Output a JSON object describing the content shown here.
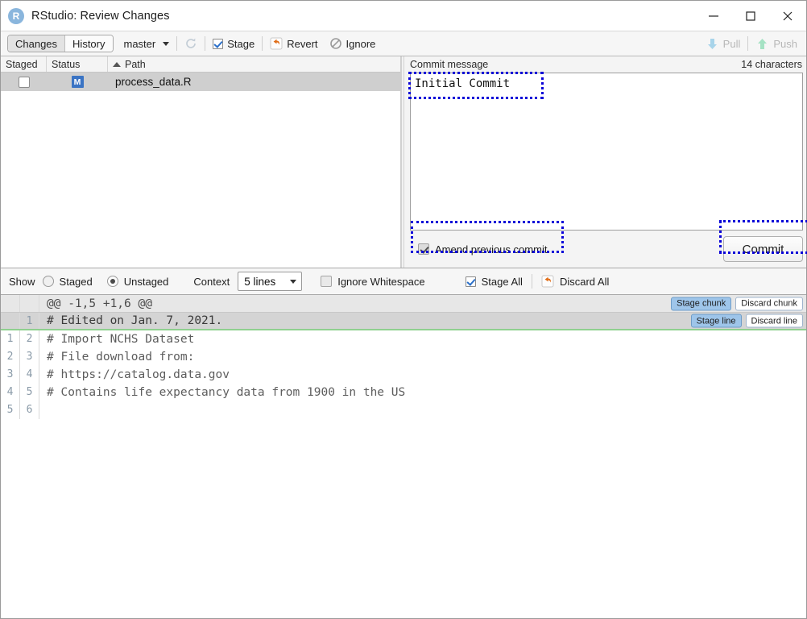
{
  "window": {
    "title": "RStudio: Review Changes",
    "logo_letter": "R",
    "logo_icon": "rstudio-logo-icon",
    "minimize_icon": "minimize-icon",
    "maximize_icon": "maximize-icon",
    "close_icon": "close-icon"
  },
  "toolbar": {
    "tab_changes": "Changes",
    "tab_history": "History",
    "branch": "master",
    "refresh_icon": "refresh-icon",
    "stage_label": "Stage",
    "revert_label": "Revert",
    "ignore_label": "Ignore",
    "pull_label": "Pull",
    "push_label": "Push"
  },
  "files": {
    "columns": [
      "Staged",
      "Status",
      "Path"
    ],
    "sort_column": "Path",
    "rows": [
      {
        "staged": false,
        "status": "M",
        "path": "process_data.R",
        "selected": true
      }
    ]
  },
  "commit": {
    "label": "Commit message",
    "char_count": "14 characters",
    "message": "Initial Commit",
    "placeholder": "",
    "amend_label": "Amend previous commit",
    "amend_checked": true,
    "button_label": "Commit"
  },
  "showbar": {
    "show_label": "Show",
    "staged_label": "Staged",
    "unstaged_label": "Unstaged",
    "selected_show": "Unstaged",
    "context_label": "Context",
    "context_value": "5 lines",
    "ignore_whitespace_label": "Ignore Whitespace",
    "ignore_whitespace_checked": false,
    "stage_all_label": "Stage All",
    "discard_all_label": "Discard All"
  },
  "diff": {
    "chunk_header": "@@ -1,5 +1,6 @@",
    "stage_chunk_label": "Stage chunk",
    "discard_chunk_label": "Discard chunk",
    "stage_line_label": "Stage line",
    "discard_line_label": "Discard line",
    "lines": [
      {
        "old": "",
        "new": "1",
        "text": "# Edited on Jan. 7, 2021.",
        "type": "added"
      },
      {
        "old": "1",
        "new": "2",
        "text": "# Import NCHS Dataset",
        "type": "context"
      },
      {
        "old": "2",
        "new": "3",
        "text": "# File download from:",
        "type": "context"
      },
      {
        "old": "3",
        "new": "4",
        "text": "# https://catalog.data.gov",
        "type": "context"
      },
      {
        "old": "4",
        "new": "5",
        "text": "# Contains life expectancy data from 1900 in the US",
        "type": "context"
      },
      {
        "old": "5",
        "new": "6",
        "text": "",
        "type": "context"
      }
    ]
  },
  "colors": {
    "accent_blue": "#3b74c4",
    "annotation": "#0a00d8",
    "added_green": "#8fd08f",
    "revert_orange": "#e06c16"
  }
}
